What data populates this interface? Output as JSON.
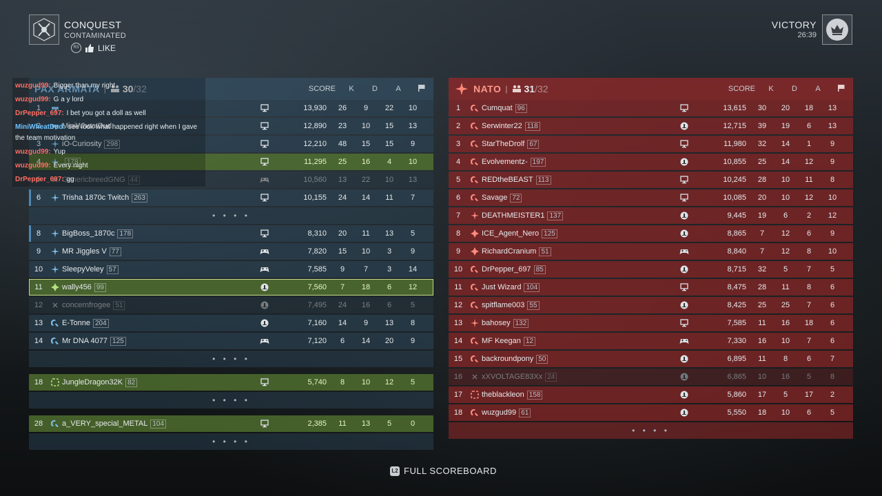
{
  "match": {
    "mode": "CONQUEST",
    "map": "CONTAMINATED",
    "like_label": "LIKE",
    "result": "VICTORY",
    "time": "26:39"
  },
  "columns": {
    "score": "SCORE",
    "k": "K",
    "d": "D",
    "a": "A"
  },
  "friendly": {
    "name": "PAX ARMATA",
    "separator": "|",
    "count": "30",
    "max": "/32",
    "color": "#7fb7e0",
    "rows": [
      {
        "rank": "1",
        "cls": "assault",
        "name": "",
        "level": "",
        "platform": "pc",
        "score": "13,930",
        "k": "26",
        "d": "9",
        "a": "22",
        "f": "10",
        "style": "normal"
      },
      {
        "rank": "2",
        "cls": "assault",
        "name": "MiniWheatDud",
        "level": "",
        "platform": "pc",
        "score": "12,890",
        "k": "23",
        "d": "10",
        "a": "15",
        "f": "13",
        "style": "normal"
      },
      {
        "rank": "3",
        "cls": "recon",
        "name": "iO-Curiosity",
        "level": "298",
        "platform": "pc",
        "score": "12,210",
        "k": "48",
        "d": "15",
        "a": "15",
        "f": "9",
        "style": "normal"
      },
      {
        "rank": "4",
        "cls": "recon",
        "name": "",
        "level": "178",
        "platform": "pc",
        "score": "11,295",
        "k": "25",
        "d": "16",
        "a": "4",
        "f": "10",
        "style": "squad"
      },
      {
        "rank": "5",
        "cls": "dead",
        "name": "GenericbreedGNG",
        "level": "44",
        "platform": "controller",
        "score": "10,560",
        "k": "13",
        "d": "22",
        "a": "10",
        "f": "13",
        "style": "dead"
      },
      {
        "rank": "6",
        "cls": "recon",
        "name": "Trisha 1870c Twitch",
        "level": "263",
        "platform": "pc",
        "score": "10,155",
        "k": "24",
        "d": "14",
        "a": "11",
        "f": "7",
        "style": "accent"
      },
      {
        "ellipsis": true
      },
      {
        "rank": "8",
        "cls": "recon",
        "name": "BigBoss_1870c",
        "level": "178",
        "platform": "pc",
        "score": "8,310",
        "k": "20",
        "d": "11",
        "a": "13",
        "f": "5",
        "style": "accent"
      },
      {
        "rank": "9",
        "cls": "recon",
        "name": "MR Jiggles V",
        "level": "77",
        "platform": "controller",
        "score": "7,820",
        "k": "15",
        "d": "10",
        "a": "3",
        "f": "9",
        "style": "normal"
      },
      {
        "rank": "10",
        "cls": "recon",
        "name": "SleepyVeley",
        "level": "57",
        "platform": "controller",
        "score": "7,585",
        "k": "9",
        "d": "7",
        "a": "3",
        "f": "14",
        "style": "normal"
      },
      {
        "rank": "11",
        "cls": "engineer",
        "name": "wally456",
        "level": "99",
        "platform": "ps",
        "score": "7,560",
        "k": "7",
        "d": "18",
        "a": "6",
        "f": "12",
        "style": "self"
      },
      {
        "rank": "12",
        "cls": "dead",
        "name": "concernfrogee",
        "level": "51",
        "platform": "ps",
        "score": "7,495",
        "k": "24",
        "d": "16",
        "a": "6",
        "f": "5",
        "style": "dead"
      },
      {
        "rank": "13",
        "cls": "support",
        "name": "E-Tonne",
        "level": "204",
        "platform": "ps",
        "score": "7,160",
        "k": "14",
        "d": "9",
        "a": "13",
        "f": "8",
        "style": "normal"
      },
      {
        "rank": "14",
        "cls": "support",
        "name": "Mr DNA 4077",
        "level": "125",
        "platform": "controller",
        "score": "7,120",
        "k": "6",
        "d": "14",
        "a": "20",
        "f": "9",
        "style": "normal"
      },
      {
        "ellipsis": true
      },
      {
        "gap": true
      },
      {
        "rank": "18",
        "cls": "medic",
        "name": "JungleDragon32K",
        "level": "82",
        "platform": "pc",
        "score": "5,740",
        "k": "8",
        "d": "10",
        "a": "12",
        "f": "5",
        "style": "squad"
      },
      {
        "ellipsis": true
      },
      {
        "gap": true
      },
      {
        "rank": "28",
        "cls": "support",
        "name": "a_VERY_special_METAL",
        "level": "104",
        "platform": "pc",
        "score": "2,385",
        "k": "11",
        "d": "13",
        "a": "5",
        "f": "0",
        "style": "squad"
      },
      {
        "ellipsis": true
      }
    ]
  },
  "enemy": {
    "name": "NATO",
    "separator": "|",
    "count": "31",
    "max": "/32",
    "color": "#ff9a8c",
    "rows": [
      {
        "rank": "1",
        "cls": "support",
        "name": "Cumquat",
        "level": "96",
        "platform": "pc",
        "score": "13,615",
        "k": "30",
        "d": "20",
        "a": "18",
        "f": "13",
        "style": "normal"
      },
      {
        "rank": "2",
        "cls": "support",
        "name": "Serwinter22",
        "level": "118",
        "platform": "ps",
        "score": "12,715",
        "k": "39",
        "d": "19",
        "a": "6",
        "f": "13",
        "style": "normal"
      },
      {
        "rank": "3",
        "cls": "support",
        "name": "StarTheDrolf",
        "level": "67",
        "platform": "pc",
        "score": "11,980",
        "k": "32",
        "d": "14",
        "a": "1",
        "f": "9",
        "style": "normal"
      },
      {
        "rank": "4",
        "cls": "support",
        "name": "Evolvementz-",
        "level": "197",
        "platform": "ps",
        "score": "10,855",
        "k": "25",
        "d": "14",
        "a": "12",
        "f": "9",
        "style": "normal"
      },
      {
        "rank": "5",
        "cls": "support",
        "name": "REDtheBEAST",
        "level": "113",
        "platform": "pc",
        "score": "10,245",
        "k": "28",
        "d": "10",
        "a": "11",
        "f": "8",
        "style": "normal"
      },
      {
        "rank": "6",
        "cls": "support",
        "name": "Savage",
        "level": "72",
        "platform": "pc",
        "score": "10,085",
        "k": "20",
        "d": "10",
        "a": "12",
        "f": "10",
        "style": "normal"
      },
      {
        "rank": "7",
        "cls": "recon",
        "name": "DEATHMEISTER1",
        "level": "137",
        "platform": "ps",
        "score": "9,445",
        "k": "19",
        "d": "6",
        "a": "2",
        "f": "12",
        "style": "normal"
      },
      {
        "rank": "8",
        "cls": "engineer",
        "name": "ICE_Agent_Nero",
        "level": "125",
        "platform": "ps",
        "score": "8,865",
        "k": "7",
        "d": "12",
        "a": "6",
        "f": "9",
        "style": "normal"
      },
      {
        "rank": "9",
        "cls": "engineer",
        "name": "RichardCranium",
        "level": "51",
        "platform": "controller",
        "score": "8,840",
        "k": "7",
        "d": "12",
        "a": "8",
        "f": "10",
        "style": "normal"
      },
      {
        "rank": "10",
        "cls": "support",
        "name": "DrPepper_697",
        "level": "85",
        "platform": "ps",
        "score": "8,715",
        "k": "32",
        "d": "5",
        "a": "7",
        "f": "5",
        "style": "normal"
      },
      {
        "rank": "11",
        "cls": "support",
        "name": "Just Wizard",
        "level": "104",
        "platform": "pc",
        "score": "8,475",
        "k": "28",
        "d": "11",
        "a": "8",
        "f": "6",
        "style": "normal"
      },
      {
        "rank": "12",
        "cls": "support",
        "name": "spitflame003",
        "level": "55",
        "platform": "ps",
        "score": "8,425",
        "k": "25",
        "d": "25",
        "a": "7",
        "f": "6",
        "style": "normal"
      },
      {
        "rank": "13",
        "cls": "recon",
        "name": "bahosey",
        "level": "132",
        "platform": "pc",
        "score": "7,585",
        "k": "11",
        "d": "16",
        "a": "18",
        "f": "6",
        "style": "normal"
      },
      {
        "rank": "14",
        "cls": "support",
        "name": "MF Keegan",
        "level": "12",
        "platform": "controller",
        "score": "7,330",
        "k": "16",
        "d": "10",
        "a": "7",
        "f": "6",
        "style": "normal"
      },
      {
        "rank": "15",
        "cls": "support",
        "name": "backroundpony",
        "level": "50",
        "platform": "ps",
        "score": "6,895",
        "k": "11",
        "d": "8",
        "a": "6",
        "f": "7",
        "style": "normal"
      },
      {
        "rank": "16",
        "cls": "dead",
        "name": "xXVOLTAGE83Xx",
        "level": "24",
        "platform": "ps",
        "score": "6,865",
        "k": "10",
        "d": "16",
        "a": "5",
        "f": "8",
        "style": "dead"
      },
      {
        "rank": "17",
        "cls": "medic",
        "name": "theblackleon",
        "level": "158",
        "platform": "ps",
        "score": "5,860",
        "k": "17",
        "d": "5",
        "a": "17",
        "f": "2",
        "style": "normal"
      },
      {
        "rank": "18",
        "cls": "support",
        "name": "wuzgud99",
        "level": "61",
        "platform": "ps",
        "score": "5,550",
        "k": "18",
        "d": "10",
        "a": "6",
        "f": "5",
        "style": "normal"
      },
      {
        "ellipsis": true
      }
    ]
  },
  "chat": [
    {
      "author": "wuzgud99:",
      "color": "red",
      "text": "Bigger than my right"
    },
    {
      "author": "wuzgud99:",
      "color": "red",
      "text": "G a y lord"
    },
    {
      "author": "DrPepper_697:",
      "color": "red",
      "text": "I bet you got a doll as well"
    },
    {
      "author": "MiniWheatDud:",
      "color": "blue",
      "text": "see look what happened right when I gave the team motivation",
      "wrap": true
    },
    {
      "author": "wuzgud99:",
      "color": "red",
      "text": "Yup"
    },
    {
      "author": "wuzgud99:",
      "color": "red",
      "text": "Every night"
    },
    {
      "author": "DrPepper_697:",
      "color": "red",
      "text": "gg"
    }
  ],
  "footer": {
    "button": "L2",
    "label": "FULL SCOREBOARD"
  }
}
